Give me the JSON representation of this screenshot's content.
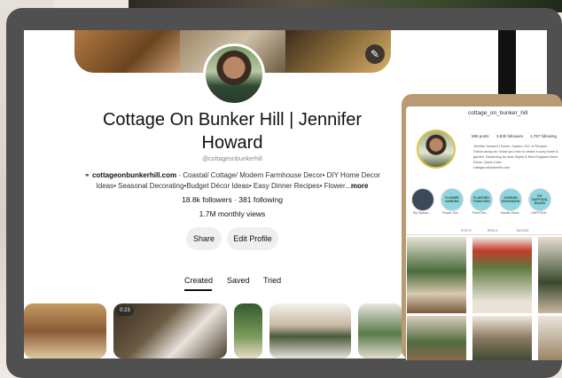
{
  "profile": {
    "title_line1": "Cottage On Bunker Hill | Jennifer",
    "title_line2": "Howard",
    "handle": "@cottageonbunkerhill",
    "website": "cottageonbunkerhill.com",
    "bio_rest_line1": "· Coastal/ Cottage/ Modern Farmhouse Decor• DIY Home Decor",
    "bio_line2": "Ideas• Seasonal Decorating•Budget Décor Ideas• Easy Dinner Recipes• Flower...",
    "more_label": "more",
    "followers": "18.8k followers · 381 following",
    "monthly_views": "1.7M monthly views"
  },
  "buttons": {
    "share": "Share",
    "edit_profile": "Edit Profile"
  },
  "tabs": {
    "created": "Created",
    "saved": "Saved",
    "tried": "Tried"
  },
  "pin_badge": "0:23",
  "phone": {
    "handle": "cottage_on_bunker_hill",
    "stats": [
      "586 posts",
      "3,830 followers",
      "1,797 following"
    ],
    "bio_name": "Jennifer Howard | Home, Garden, DIY, & Recipes",
    "bio_text": "Follow along as I show you how to create a cozy home & garden. Gardening for slow Stylist & New England Home Décor. Quick Links",
    "bio_link": "cottageonbunkerhill.com",
    "highlights": [
      {
        "bubble": "",
        "label": "Diy Hydran..."
      },
      {
        "bubble": "FLOWER GARDEN",
        "label": "Flower Gar..."
      },
      {
        "bubble": "PLANTING TOMATOES",
        "label": "Plant Tom..."
      },
      {
        "bubble": "GARDEN EXPANSION",
        "label": "Garden Work"
      },
      {
        "bubble": "DIY DAFFODIL BULBS",
        "label": "DAFFODIL"
      }
    ],
    "tab_labels": [
      "POSTS",
      "REELS",
      "TAGGED"
    ]
  },
  "icons": {
    "edit_cover": "pencil-icon",
    "website": "link-icon"
  },
  "colors": {
    "phone_frame": "#b99a72",
    "tablet_frame": "#505050",
    "button_bg": "#efefef",
    "highlight_bubble": "#8fd6e0"
  }
}
